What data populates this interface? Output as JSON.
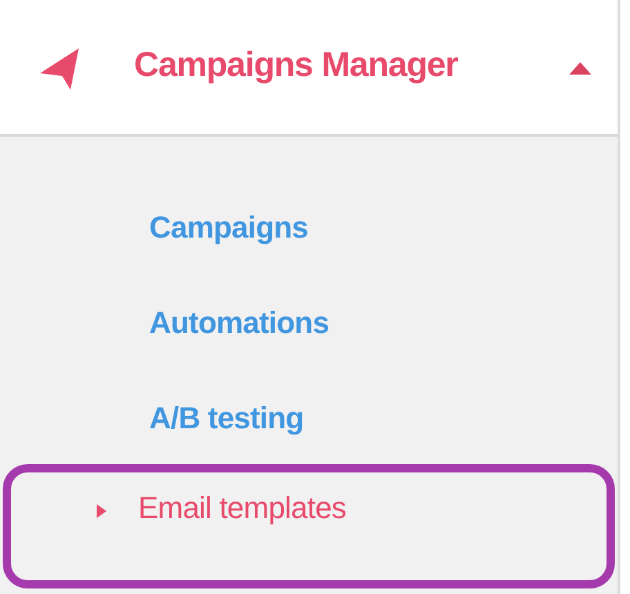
{
  "menu": {
    "title": "Campaigns Manager",
    "expanded": true,
    "items": [
      {
        "label": "Campaigns",
        "selected": false
      },
      {
        "label": "Automations",
        "selected": false
      },
      {
        "label": "A/B testing",
        "selected": false
      },
      {
        "label": "Email templates",
        "selected": true
      }
    ]
  }
}
